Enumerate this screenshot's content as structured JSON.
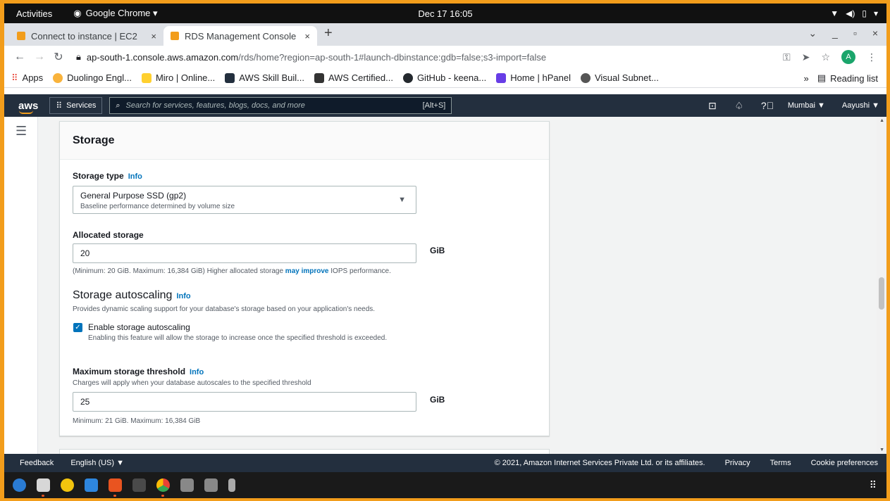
{
  "gnome": {
    "activities": "Activities",
    "app_name": "Google Chrome ▾",
    "clock": "Dec 17  16:05",
    "tray": "▾"
  },
  "tabs": [
    {
      "title": "Connect to instance | EC2",
      "close": "×"
    },
    {
      "title": "RDS Management Console",
      "close": "×"
    }
  ],
  "new_tab": "+",
  "window_controls": {
    "dropdown": "⌄",
    "minimize": "_",
    "restore": "▫",
    "close": "×"
  },
  "address": {
    "host": "ap-south-1.console.aws.amazon.com",
    "path": "/rds/home?region=ap-south-1#launch-dbinstance:gdb=false;s3-import=false",
    "profile_initial": "A"
  },
  "bookmarks": {
    "items": [
      {
        "label": "Apps",
        "color": "#e94235"
      },
      {
        "label": "Duolingo Engl...",
        "color": "#f9b33c"
      },
      {
        "label": "Miro | Online...",
        "color": "#ffd02f"
      },
      {
        "label": "AWS Skill Buil...",
        "color": "#232f3e"
      },
      {
        "label": "AWS Certified...",
        "color": "#333333"
      },
      {
        "label": "GitHub - keena...",
        "color": "#24292e"
      },
      {
        "label": "Home | hPanel",
        "color": "#673de6"
      },
      {
        "label": "Visual Subnet...",
        "color": "#555555"
      }
    ],
    "overflow": "»",
    "reading_list": "Reading list"
  },
  "aws_header": {
    "logo": "aws",
    "services": "Services",
    "search_placeholder": "Search for services, features, blogs, docs, and more",
    "search_shortcut": "[Alt+S]",
    "region": "Mumbai ▼",
    "user": "Aayushi ▼"
  },
  "storage": {
    "title": "Storage",
    "storage_type_label": "Storage type",
    "info": "Info",
    "storage_type_value": "General Purpose SSD (gp2)",
    "storage_type_desc": "Baseline performance determined by volume size",
    "allocated_label": "Allocated storage",
    "allocated_value": "20",
    "unit": "GiB",
    "allocated_hint_pre": "(Minimum: 20 GiB. Maximum: 16,384 GiB) Higher allocated storage ",
    "allocated_hint_link": "may improve",
    "allocated_hint_post": " IOPS performance.",
    "autoscaling_title": "Storage autoscaling",
    "autoscaling_desc": "Provides dynamic scaling support for your database's storage based on your application's needs.",
    "enable_label": "Enable storage autoscaling",
    "enable_desc": "Enabling this feature will allow the storage to increase once the specified threshold is exceeded.",
    "enable_checked": true,
    "max_label": "Maximum storage threshold",
    "max_desc": "Charges will apply when your database autoscales to the specified threshold",
    "max_value": "25",
    "max_hint": "Minimum: 21 GiB. Maximum: 16,384 GiB"
  },
  "footer": {
    "feedback": "Feedback",
    "language": "English (US) ▼",
    "copyright": "© 2021, Amazon Internet Services Private Ltd. or its affiliates.",
    "privacy": "Privacy",
    "terms": "Terms",
    "cookies": "Cookie preferences"
  },
  "dock": {
    "apps": [
      {
        "name": "thunderbird",
        "color": "#2a7bd3"
      },
      {
        "name": "files",
        "color": "#d7d7d7"
      },
      {
        "name": "rhythmbox",
        "color": "#f2c40e"
      },
      {
        "name": "writer",
        "color": "#2e86de"
      },
      {
        "name": "software",
        "color": "#e95420"
      },
      {
        "name": "terminal",
        "color": "#4a4a4a"
      },
      {
        "name": "chrome",
        "color": "#e94235"
      },
      {
        "name": "disks-1",
        "color": "#888888"
      },
      {
        "name": "disks-2",
        "color": "#888888"
      },
      {
        "name": "usb",
        "color": "#aaaaaa"
      }
    ],
    "grid": "⠿"
  }
}
